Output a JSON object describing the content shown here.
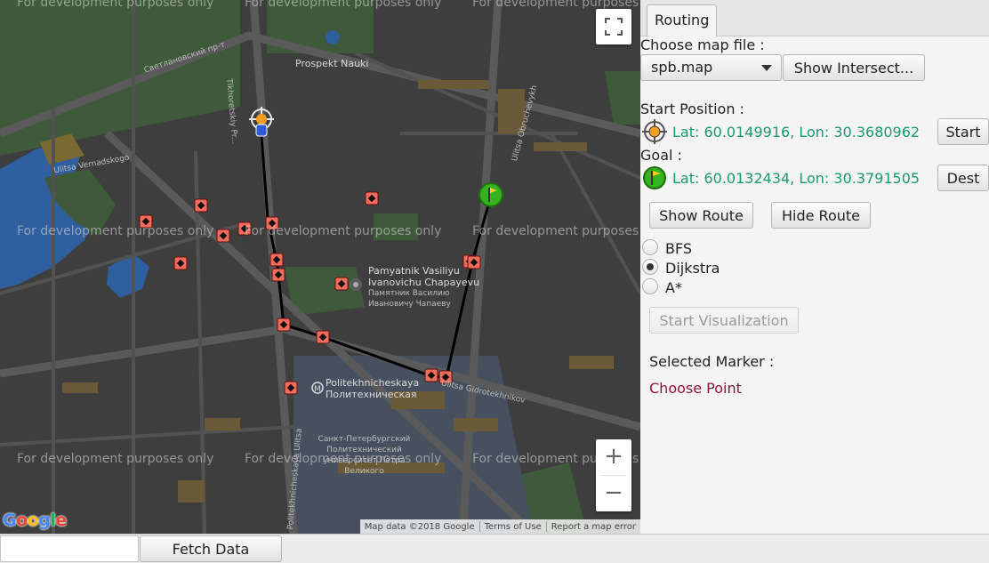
{
  "map": {
    "watermark": "For development purposes only",
    "labels": {
      "prospekt_nauki": "Prospekt Nauki",
      "svetlanovskiy": "Светлановский пр-т",
      "tikhoretskiy": "Tikhoretskiy Pr...",
      "monument_en": "Pamyatnik Vasiliyu Ivanovichu Chapayevu",
      "monument_ru": "Памятник Василию Ивановичу Чапаеву",
      "metro_en": "Politekhnicheskaya",
      "metro_ru": "Политехническая",
      "university": "Санкт-Петербургский Политехнический университет Петра Великого",
      "ulitsa_gidrotekhnikov": "Ulitsa Gidrotekhnikov",
      "ulitsa_obruchevykh": "Ulitsa Obruchevykh",
      "ulitsa_vernadskogo": "Ulitsa Vernadskogo",
      "politekhnicheskaya_ulitsa": "Politekhnicheskaya Ulitsa"
    },
    "zoom_in": "+",
    "zoom_out": "−",
    "google": "Google",
    "attribution": {
      "map_data": "Map data ©2018 Google",
      "terms": "Terms of Use",
      "report": "Report a map error"
    },
    "colors": {
      "route": "#000000",
      "marker": "#f26b5b",
      "start": "#2f5bd8",
      "goal": "#34b31f"
    }
  },
  "panel": {
    "tab": "Routing",
    "choose_map_label": "Choose map file :",
    "map_file": "spb.map",
    "show_intersections": "Show Intersect...",
    "start_position_label": "Start Position :",
    "start_coords": "Lat: 60.0149916, Lon: 30.3680962",
    "start_button": "Start",
    "goal_label": "Goal :",
    "goal_coords": "Lat: 60.0132434, Lon: 30.3791505",
    "dest_button": "Dest",
    "show_route": "Show Route",
    "hide_route": "Hide Route",
    "algorithms": [
      "BFS",
      "Dijkstra",
      "A*"
    ],
    "selected_algorithm": "Dijkstra",
    "start_visualization": "Start Visualization",
    "selected_marker_label": "Selected Marker :",
    "choose_point": "Choose Point"
  },
  "bottom": {
    "fetch_input_value": "",
    "fetch_button": "Fetch Data"
  }
}
